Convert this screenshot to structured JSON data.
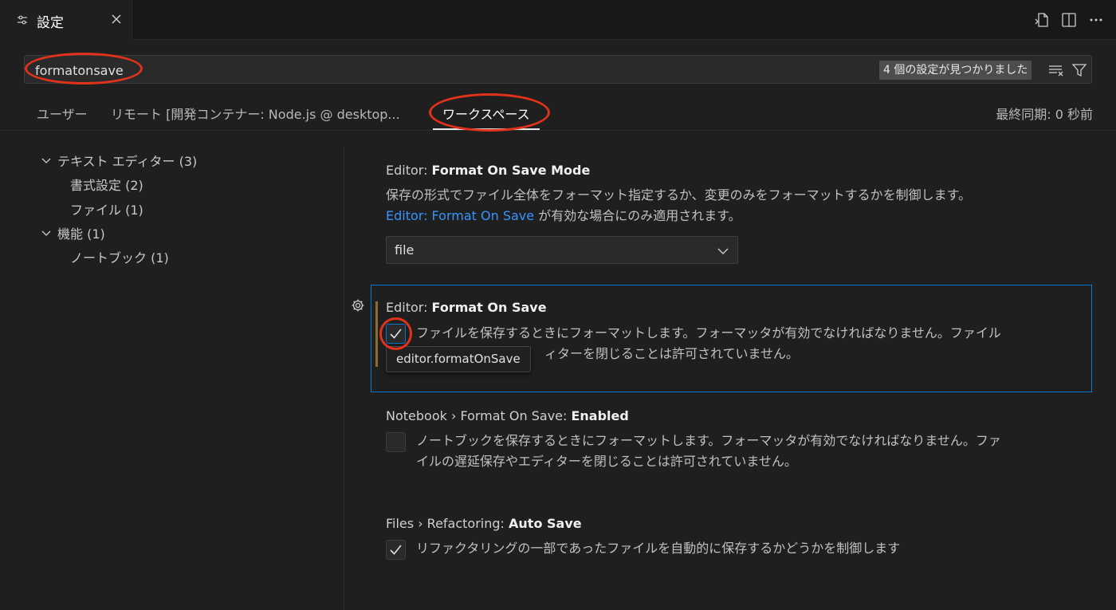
{
  "tab": {
    "title": "設定"
  },
  "search": {
    "value": "formatonsave",
    "result_count": "4 個の設定が見つかりました"
  },
  "scope_tabs": {
    "user": "ユーザー",
    "remote": "リモート [開発コンテナー: Node.js @ desktop...",
    "workspace": "ワークスペース",
    "last_sync": "最終同期: 0 秒前"
  },
  "tree": {
    "text_editor": "テキスト エディター (3)",
    "formatting": "書式設定 (2)",
    "files": "ファイル (1)",
    "features": "機能 (1)",
    "notebook": "ノートブック (1)"
  },
  "settings": {
    "format_on_save_mode": {
      "category": "Editor: ",
      "name": "Format On Save Mode",
      "desc_line1": "保存の形式でファイル全体をフォーマット指定するか、変更のみをフォーマットするかを制御します。",
      "desc_link": "Editor: Format On Save",
      "desc_line2_rest": " が有効な場合にのみ適用されます。",
      "value": "file"
    },
    "format_on_save": {
      "category": "Editor: ",
      "name": "Format On Save",
      "desc_line1": "ファイルを保存するときにフォーマットします。フォーマッタが有効でなければなりません。ファイル",
      "desc_line2": "ィターを閉じることは許可されていません。",
      "checked": true,
      "tooltip": "editor.formatOnSave"
    },
    "notebook_format_on_save": {
      "category": "Notebook › Format On Save: ",
      "name": "Enabled",
      "desc_line1": "ノートブックを保存するときにフォーマットします。フォーマッタが有効でなければなりません。ファ",
      "desc_line2": "イルの遅延保存やエディターを閉じることは許可されていません。",
      "checked": false
    },
    "refactoring_auto_save": {
      "category": "Files › Refactoring: ",
      "name": "Auto Save",
      "desc_line1": "リファクタリングの一部であったファイルを自動的に保存するかどうかを制御します",
      "checked": true
    }
  },
  "colors": {
    "background": "#1f1f1f",
    "accent": "#0078d4",
    "link": "#3794ff",
    "annotation": "#e2321c"
  }
}
